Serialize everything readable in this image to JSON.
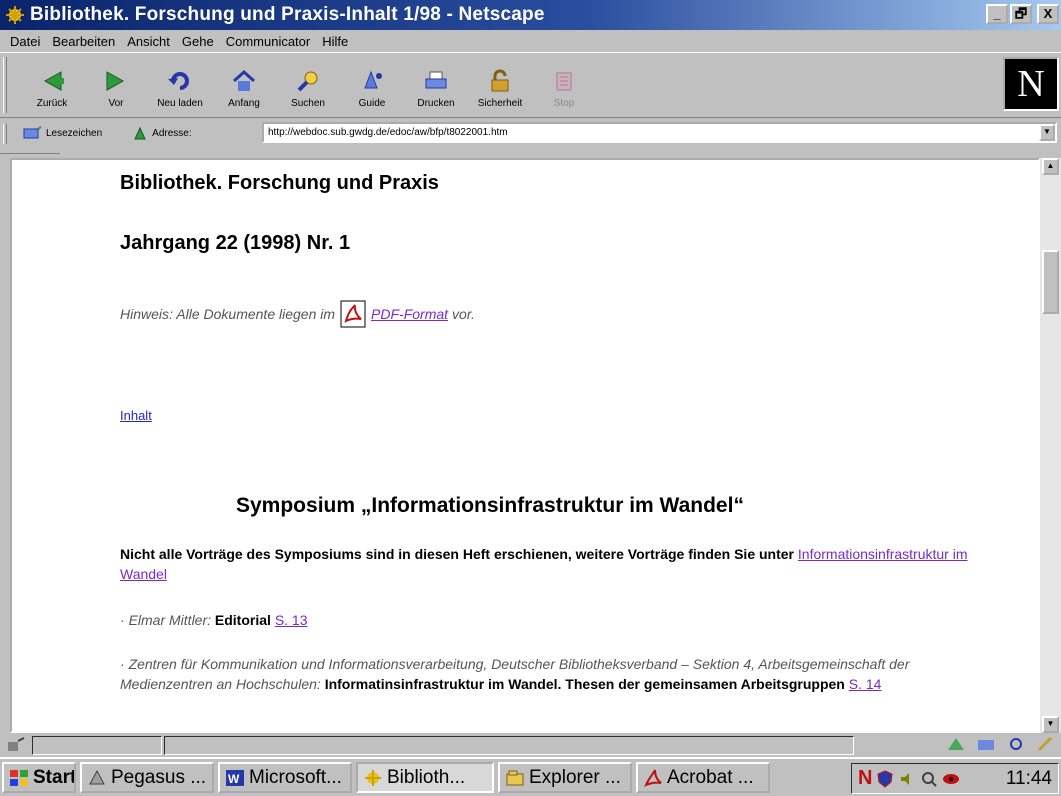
{
  "window": {
    "title": "Bibliothek. Forschung und Praxis-Inhalt 1/98 - Netscape",
    "btn_minimize": "_",
    "btn_maximize": "🗗",
    "btn_close": "X"
  },
  "menu": [
    {
      "label": "Datei"
    },
    {
      "label": "Bearbeiten"
    },
    {
      "label": "Ansicht"
    },
    {
      "label": "Gehe"
    },
    {
      "label": "Communicator"
    },
    {
      "label": "Hilfe"
    }
  ],
  "toolbar": {
    "back": "Zurück",
    "forward": "Vor",
    "reload": "Neu laden",
    "home": "Anfang",
    "search": "Suchen",
    "guide": "Guide",
    "print": "Drucken",
    "security": "Sicherheit",
    "stop": "Stop",
    "logo": "N"
  },
  "location": {
    "bookmarks_label": "Lesezeichen",
    "address_label": "Adresse:",
    "url": "http://webdoc.sub.gwdg.de/edoc/aw/bfp/t8022001.htm"
  },
  "page": {
    "title": "Bibliothek. Forschung und Praxis",
    "volume": "Jahrgang 22 (1998) Nr. 1",
    "note_prefix": "Hinweis: Alle Dokumente liegen im",
    "pdf_link": "PDF-Format",
    "note_suffix": "vor.",
    "inhalt_link": "Inhalt",
    "symposium_heading": "Symposium „Informationsinfrastruktur im Wandel“",
    "intro_bold": "Nicht alle Vorträge des Symposiums sind in diesen Heft erschienen, weitere Vorträge finden Sie unter",
    "intro_link": "Informationsinfrastruktur im Wandel",
    "entries": [
      {
        "bullet": "·",
        "author": "Elmar Mittler:",
        "title": "Editorial",
        "page_link": "S. 13"
      },
      {
        "bullet": "·",
        "author": "Zentren für Kommunikation und Informationsverarbeitung, Deutscher Bibliotheksverband – Sektion 4, Arbeitsgemeinschaft der Medienzentren an Hochschulen:",
        "title": "Informatinsinfrastruktur im Wandel. Thesen der gemeinsamen Arbeitsgruppen",
        "page_link": "S. 14"
      }
    ]
  },
  "taskbar": {
    "start": "Start",
    "tasks": [
      {
        "label": "Pegasus ..."
      },
      {
        "label": "Microsoft..."
      },
      {
        "label": "Biblioth..."
      },
      {
        "label": "Explorer ..."
      },
      {
        "label": "Acrobat ..."
      }
    ],
    "clock": "11:44"
  },
  "colors": {
    "title_bar": "#0a246a",
    "link": "#2424c8",
    "visited_link": "#7a2ac8",
    "chrome": "#c0c0c0"
  }
}
